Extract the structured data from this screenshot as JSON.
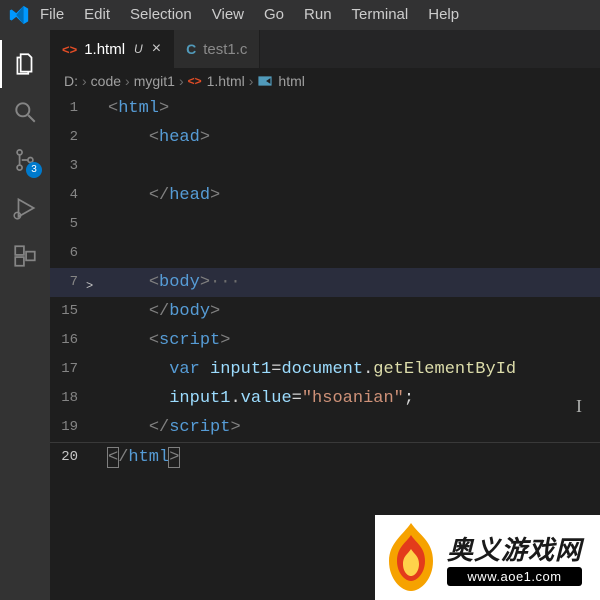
{
  "menubar": {
    "items": [
      "File",
      "Edit",
      "Selection",
      "View",
      "Go",
      "Run",
      "Terminal",
      "Help"
    ]
  },
  "activitybar": {
    "scm_badge": "3"
  },
  "tabs": [
    {
      "label": "1.html",
      "icon": "<>",
      "modified": "U",
      "active": true,
      "closeable": true
    },
    {
      "label": "test1.c",
      "icon": "C",
      "modified": "",
      "active": false,
      "closeable": false
    }
  ],
  "breadcrumbs": {
    "parts": [
      {
        "label": "D:",
        "icon": ""
      },
      {
        "label": "code",
        "icon": ""
      },
      {
        "label": "mygit1",
        "icon": ""
      },
      {
        "label": "1.html",
        "icon": "html"
      },
      {
        "label": "html",
        "icon": "tag"
      }
    ]
  },
  "code": {
    "lines": [
      {
        "n": "1"
      },
      {
        "n": "2"
      },
      {
        "n": "3"
      },
      {
        "n": "4"
      },
      {
        "n": "5"
      },
      {
        "n": "6"
      },
      {
        "n": "7",
        "fold": ">"
      },
      {
        "n": "15"
      },
      {
        "n": "16"
      },
      {
        "n": "17"
      },
      {
        "n": "18"
      },
      {
        "n": "19"
      },
      {
        "n": "20"
      }
    ],
    "tokens": {
      "html_open": "html",
      "head_open": "head",
      "head_close": "head",
      "body_open": "body",
      "body_close": "body",
      "script_open": "script",
      "var_kw": "var",
      "input1": "input1",
      "document": "document",
      "getElById": "getElementById",
      "value": "value",
      "hsoanian": "\"hsoanian\"",
      "script_close": "script",
      "html_close": "html",
      "dots": "···"
    }
  },
  "watermark": {
    "main": "奥义游戏网",
    "url": "www.aoe1.com"
  }
}
